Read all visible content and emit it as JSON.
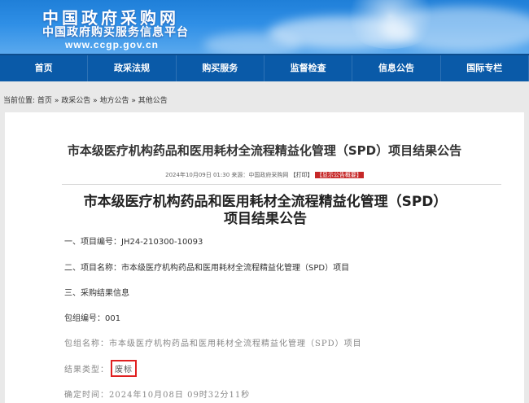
{
  "header": {
    "logo_line1": "中国政府采购网",
    "logo_line2": "中国政府购买服务信息平台",
    "logo_url": "www.ccgp.gov.cn"
  },
  "nav": {
    "items": [
      "首页",
      "政采法规",
      "购买服务",
      "监督检查",
      "信息公告",
      "国际专栏"
    ]
  },
  "breadcrumb": {
    "prefix": "当前位置:",
    "items": [
      "首页",
      "政采公告",
      "地方公告",
      "其他公告"
    ],
    "separator": "»"
  },
  "article": {
    "title": "市本级医疗机构药品和医用耗材全流程精益化管理（SPD）项目结果公告",
    "meta_date": "2024年10月09日 01:30",
    "meta_source": "来源：中国政府采购网",
    "print_label": "【打印】",
    "summary_label": "【显示公告概要】",
    "doc_title_line1": "市本级医疗机构药品和医用耗材全流程精益化管理（SPD）",
    "doc_title_line2": "项目结果公告",
    "project_no": "一、项目编号：JH24-210300-10093",
    "project_name": "二、项目名称：市本级医疗机构药品和医用耗材全流程精益化管理（SPD）项目",
    "section3": "三、采购结果信息",
    "package_no": "包组编号：001",
    "package_name": "包组名称：市本级医疗机构药品和医用耗材全流程精益化管理（SPD）项目",
    "result_type_label": "结果类型：",
    "result_type_value": "废标",
    "confirm_time": "确定时间：2024年10月08日 09时32分11秒"
  },
  "colors": {
    "nav_bg": "#0a5aa8",
    "banner_bg": "#2f8fe6",
    "highlight_border": "#e02020",
    "summary_button": "#c62828"
  }
}
